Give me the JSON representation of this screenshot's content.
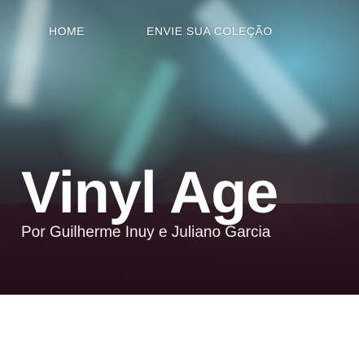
{
  "nav": {
    "home_label": "HOME",
    "submit_label": "ENVIE SUA COLEÇÃO"
  },
  "hero": {
    "title": "Vinyl Age",
    "byline": "Por Guilherme Inuy e Juliano Garcia"
  }
}
